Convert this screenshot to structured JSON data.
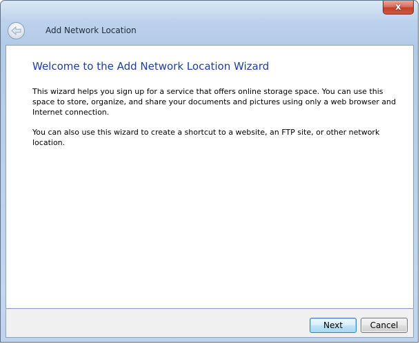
{
  "window": {
    "title": "Add Network Location",
    "close_glyph": "x"
  },
  "icons": {
    "back": "back-arrow-icon"
  },
  "main": {
    "heading": "Welcome to the Add Network Location Wizard",
    "paragraph1": "This wizard helps you sign up for a service that offers online storage space.  You can use this space to store, organize, and share your documents and pictures using only a web browser and Internet connection.",
    "paragraph2": "You can also use this wizard to create a shortcut to a website, an FTP site, or other network location."
  },
  "footer": {
    "next_label": "Next",
    "cancel_label": "Cancel"
  },
  "colors": {
    "heading": "#1e3d9c",
    "close_button": "#c2402a",
    "next_button_border": "#3c7fb1"
  }
}
